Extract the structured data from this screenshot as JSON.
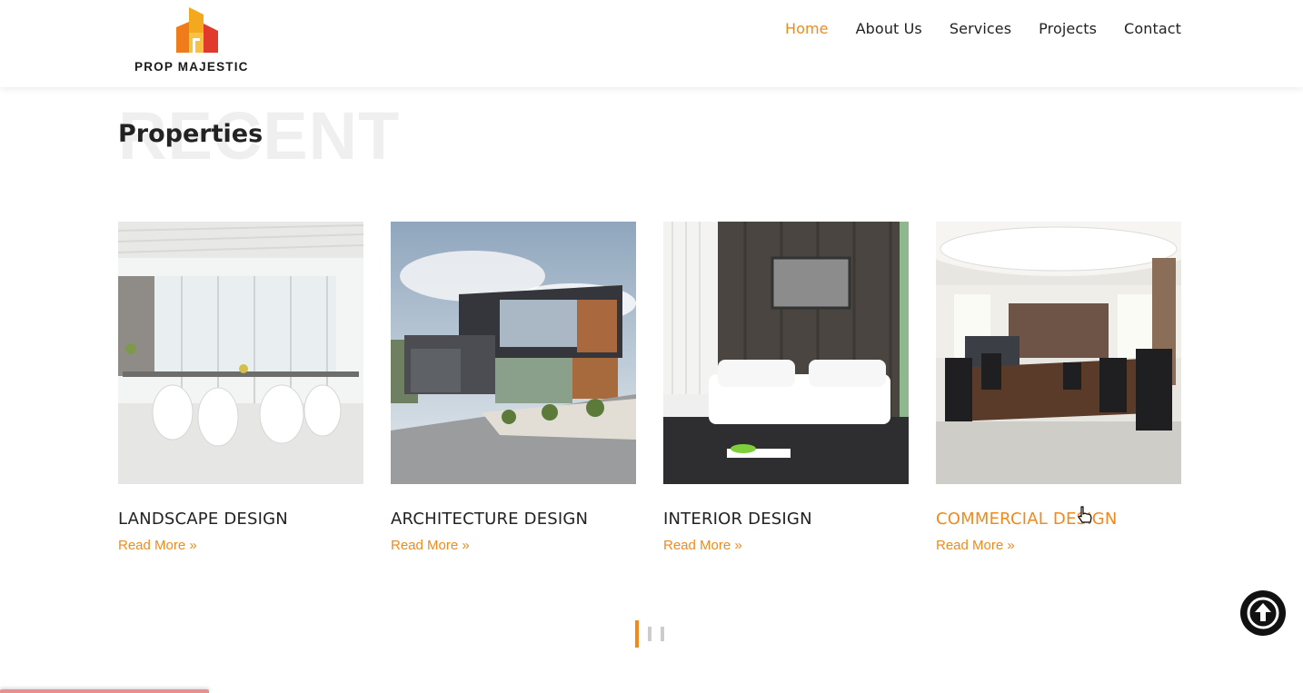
{
  "brand": {
    "name": "PROP MAJESTIC",
    "accent_color": "#f08a1c"
  },
  "nav": {
    "items": [
      {
        "label": "Home",
        "active": true
      },
      {
        "label": "About Us",
        "active": false
      },
      {
        "label": "Services",
        "active": false
      },
      {
        "label": "Projects",
        "active": false
      },
      {
        "label": "Contact",
        "active": false
      }
    ]
  },
  "section": {
    "background_word": "RECENT",
    "title": "Properties"
  },
  "cards": [
    {
      "title": "LANDSCAPE DESIGN",
      "link": "Read More »",
      "image": "bright white dining room with large windows"
    },
    {
      "title": "ARCHITECTURE DESIGN",
      "link": "Read More »",
      "image": "modern two-storey house exterior"
    },
    {
      "title": "INTERIOR DESIGN",
      "link": "Read More »",
      "image": "lounge with white sofa and wall-mounted TV"
    },
    {
      "title": "COMMERCIAL DESIGN",
      "link": "Read More »",
      "image": "conference room with oval table and black chairs",
      "hovered": true
    }
  ],
  "carousel": {
    "pages": 3,
    "active_page": 1
  },
  "icons": {
    "back_to_top": "arrow-up-circle-icon",
    "cursor": "hand-pointer-icon"
  }
}
